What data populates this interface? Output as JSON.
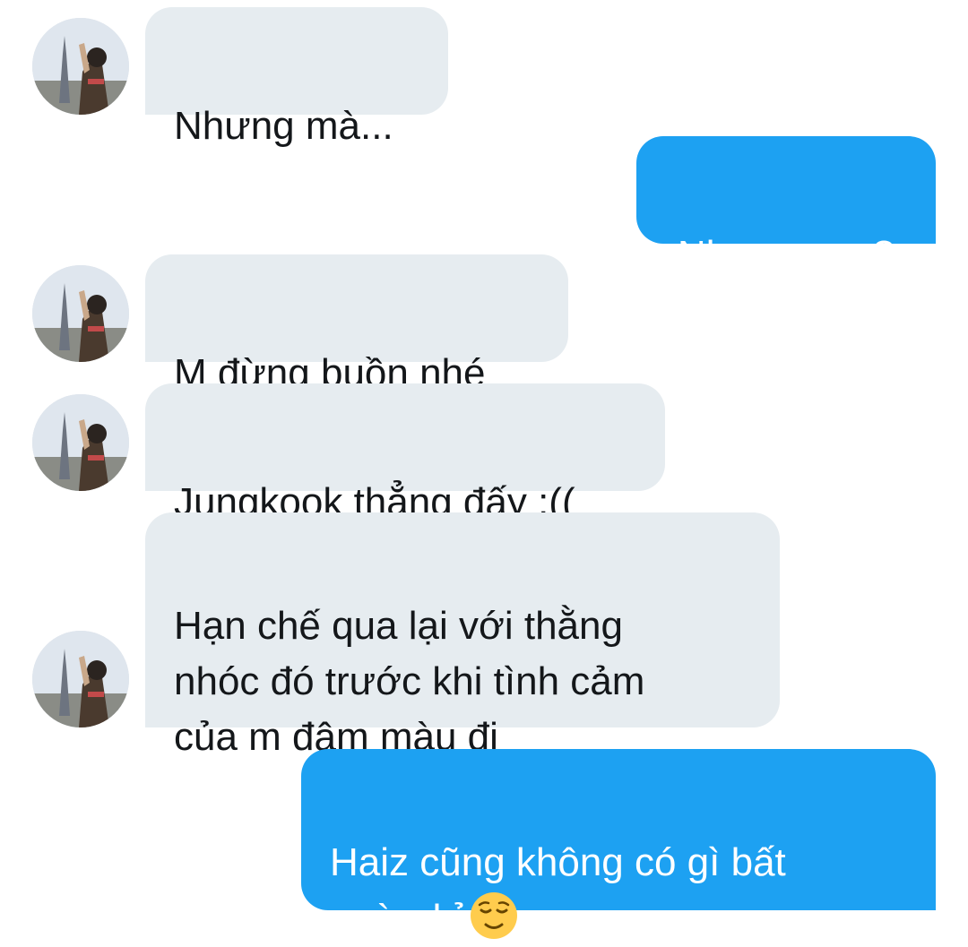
{
  "conversation": {
    "messages": [
      {
        "sender": "other",
        "text": "Nhưng mà..."
      },
      {
        "sender": "me",
        "text": "Nhưng sao?"
      },
      {
        "sender": "other",
        "text": "M đừng buồn nhé"
      },
      {
        "sender": "other",
        "text": "Jungkook thẳng đấy :(("
      },
      {
        "sender": "other",
        "text": "Hạn chế qua lại với thằng\nnhóc đó trước khi tình cảm\ncủa m đậm màu đi"
      },
      {
        "sender": "me",
        "text": "Haiz cũng không có gì bất\nngờ nhỉ",
        "emoji": "relieved-face-emoji"
      }
    ]
  },
  "colors": {
    "incoming_bubble": "#e6ecf0",
    "outgoing_bubble": "#1da1f2",
    "incoming_text": "#14171a",
    "outgoing_text": "#ffffff"
  }
}
